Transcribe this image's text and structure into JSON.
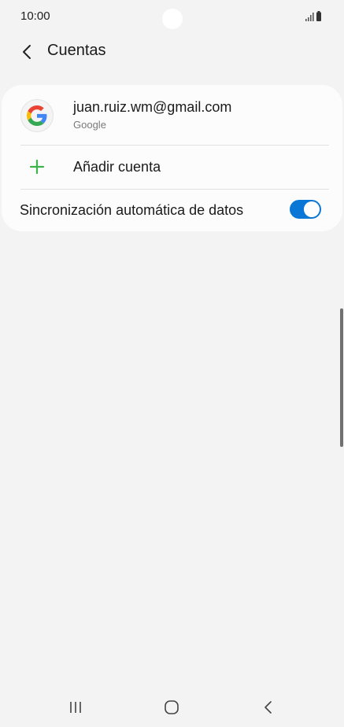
{
  "status_bar": {
    "time": "10:00",
    "icons": [
      "signal-icon",
      "battery-icon"
    ]
  },
  "header": {
    "back_icon": "chevron-left-icon",
    "title": "Cuentas"
  },
  "accounts": [
    {
      "icon": "google-icon",
      "email": "juan.ruiz.wm@gmail.com",
      "type": "Google"
    }
  ],
  "add_account": {
    "icon": "plus-icon",
    "label": "Añadir cuenta"
  },
  "sync": {
    "label": "Sincronización automática de datos",
    "enabled": true
  },
  "nav_bar": {
    "icons": [
      "recent-apps-icon",
      "home-icon",
      "back-icon"
    ]
  },
  "colors": {
    "background": "#f3f3f3",
    "card": "#fcfcfc",
    "toggle_on": "#0a77d6",
    "plus_green": "#3cb44b"
  }
}
